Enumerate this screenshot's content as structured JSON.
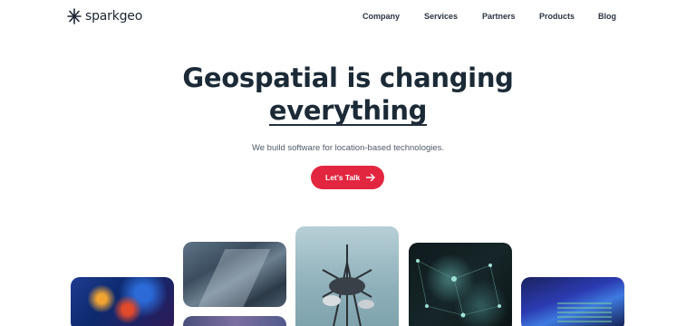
{
  "brand": {
    "name": "sparkgeo"
  },
  "nav": {
    "links": [
      {
        "label": "Company"
      },
      {
        "label": "Services"
      },
      {
        "label": "Partners"
      },
      {
        "label": "Products"
      },
      {
        "label": "Blog"
      }
    ]
  },
  "hero": {
    "title_line1": "Geospatial is changing",
    "title_line2": "everything",
    "subtitle": "We build software for location-based technologies.",
    "cta_label": "Let's Talk",
    "cta_color": "#e3263f"
  },
  "gallery": {
    "images": [
      {
        "subject": "nebula"
      },
      {
        "subject": "city-aerial"
      },
      {
        "subject": "city-aerial-2"
      },
      {
        "subject": "tower-satellite-dish"
      },
      {
        "subject": "network-visualization"
      },
      {
        "subject": "code-screen"
      }
    ]
  },
  "icons": {
    "logo": "spark-star-icon",
    "cta": "arrow-right-icon"
  }
}
